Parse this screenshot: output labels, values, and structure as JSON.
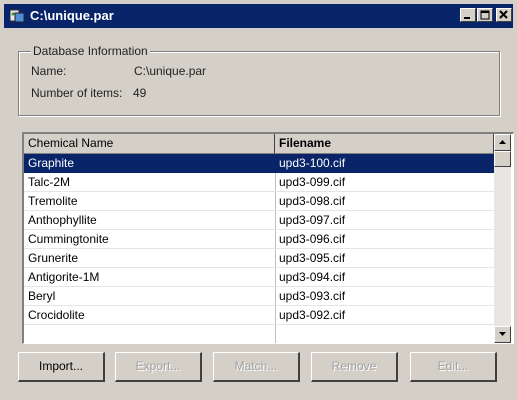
{
  "window": {
    "title": "C:\\unique.par",
    "buttons": {
      "minimize": "minimize-icon",
      "maximize": "maximize-icon",
      "close": "close-icon"
    }
  },
  "database_info": {
    "legend": "Database Information",
    "name_label": "Name:",
    "name_value": "C:\\unique.par",
    "count_label": "Number of items:",
    "count_value": "49"
  },
  "list": {
    "columns": [
      "Chemical Name",
      "Filename"
    ],
    "rows": [
      {
        "name": "Graphite",
        "file": "upd3-100.cif"
      },
      {
        "name": "Talc-2M",
        "file": "upd3-099.cif"
      },
      {
        "name": "Tremolite",
        "file": "upd3-098.cif"
      },
      {
        "name": "Anthophyllite",
        "file": "upd3-097.cif"
      },
      {
        "name": "Cummingtonite",
        "file": "upd3-096.cif"
      },
      {
        "name": "Grunerite",
        "file": "upd3-095.cif"
      },
      {
        "name": "Antigorite-1M",
        "file": "upd3-094.cif"
      },
      {
        "name": "Beryl",
        "file": "upd3-093.cif"
      },
      {
        "name": "Crocidolite",
        "file": "upd3-092.cif"
      }
    ],
    "selected_row": "Graphite"
  },
  "buttons": {
    "import": "Import...",
    "export": "Export...",
    "match": "Match...",
    "remove": "Remove",
    "edit": "Edit..."
  },
  "colors": {
    "titlebar": "#0a246a",
    "selection": "#0a246a",
    "face": "#d4d0c8"
  }
}
